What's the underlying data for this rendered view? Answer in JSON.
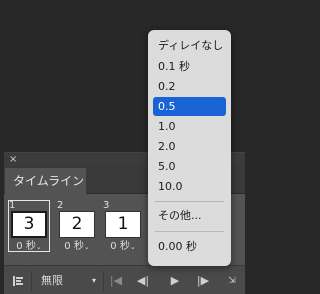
{
  "panel": {
    "close_glyph": "×",
    "tab_label": "タイムライン"
  },
  "frames": [
    {
      "num": "1",
      "thumb": "3",
      "delay": "0 秒",
      "chev": "⌄"
    },
    {
      "num": "2",
      "thumb": "2",
      "delay": "0 秒",
      "chev": "⌄"
    },
    {
      "num": "3",
      "thumb": "1",
      "delay": "0 秒",
      "chev": "⌄"
    }
  ],
  "controls": {
    "loop_value": "無限",
    "loop_caret": "▾",
    "first_frame": "|◀",
    "prev_frame": "◀|",
    "play": "▶",
    "next_frame": "|▶",
    "tween": "⇲"
  },
  "menu": {
    "items": [
      "ディレイなし",
      "0.1 秒",
      "0.2",
      "0.5",
      "1.0",
      "2.0",
      "5.0",
      "10.0",
      "その他...",
      "0.00 秒"
    ],
    "selected": "0.5"
  },
  "colors": {
    "background": "#282828",
    "panel": "#535353",
    "menu_bg": "#dcdcdc",
    "accent": "#1a63d6"
  }
}
